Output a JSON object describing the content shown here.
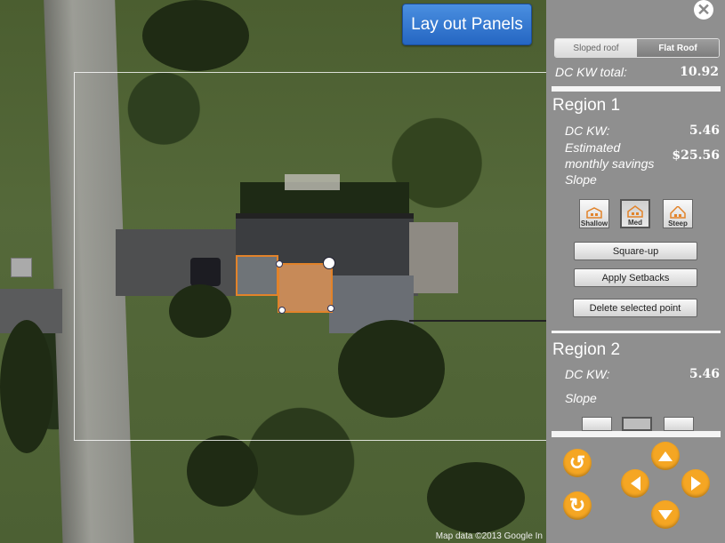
{
  "map": {
    "layout_button_label": "Lay out Panels",
    "attribution": "Map data ©2013 Google In"
  },
  "panel": {
    "close_icon": "close-icon",
    "roof_toggle": {
      "sloped_label": "Sloped roof",
      "flat_label": "Flat Roof",
      "selected": "Flat Roof"
    },
    "dc_total_label": "DC KW total:",
    "dc_total_value": "10.92",
    "region1": {
      "title": "Region 1",
      "dc_label": "DC KW:",
      "dc_value": "5.46",
      "savings_label_1": "Estimated",
      "savings_label_2": "monthly savings",
      "savings_value": "$25.56",
      "slope_label": "Slope",
      "slope_options": [
        "Shallow",
        "Med",
        "Steep"
      ],
      "slope_selected": "Med",
      "square_up_label": "Square-up",
      "apply_setbacks_label": "Apply Setbacks",
      "delete_point_label": "Delete selected point"
    },
    "region2": {
      "title": "Region 2",
      "dc_label": "DC KW:",
      "dc_value": "5.46",
      "slope_label": "Slope"
    },
    "nav": {
      "rotate_ccw_icon": "rotate-ccw-icon",
      "rotate_cw_icon": "rotate-cw-icon",
      "up_icon": "arrow-up-icon",
      "down_icon": "arrow-down-icon",
      "left_icon": "arrow-left-icon",
      "right_icon": "arrow-right-icon"
    }
  },
  "colors": {
    "accent_orange": "#f5a623",
    "panel_gray": "#8f8f8f",
    "button_blue": "#3478d4",
    "panel_outline": "#e2832a"
  }
}
